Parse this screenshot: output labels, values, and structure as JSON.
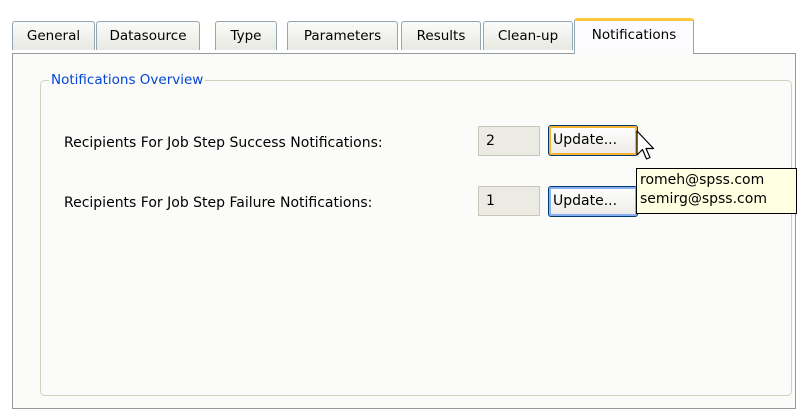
{
  "tabs": [
    {
      "label": "General"
    },
    {
      "label": "Datasource"
    },
    {
      "label": "Type"
    },
    {
      "label": "Parameters"
    },
    {
      "label": "Results"
    },
    {
      "label": "Clean-up"
    },
    {
      "label": "Notifications"
    }
  ],
  "active_tab": "Notifications",
  "group": {
    "title": "Notifications Overview"
  },
  "success": {
    "label": "Recipients For Job Step Success Notifications:",
    "count": "2",
    "button_label": "Update..."
  },
  "failure": {
    "label": "Recipients For Job Step Failure Notifications:",
    "count": "1",
    "button_label": "Update..."
  },
  "tooltip": {
    "lines": [
      "romeh@spss.com",
      "semirg@spss.com"
    ]
  },
  "colors": {
    "active_tab_accent": "#ffc73c",
    "group_title": "#0046d5",
    "tooltip_bg": "#ffffe1"
  }
}
